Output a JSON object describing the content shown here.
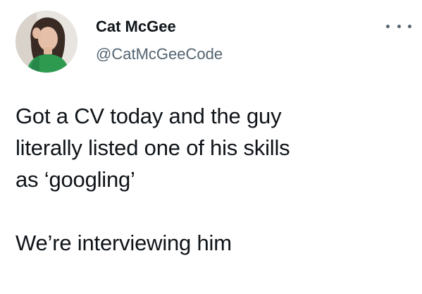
{
  "tweet": {
    "author": {
      "display_name": "Cat McGee",
      "handle": "@CatMcGeeCode",
      "avatar_icon": "profile-photo"
    },
    "more_icon": "more-options-icon",
    "text": "Got a CV today and the guy\nliterally listed one of his skills\nas ‘googling’\n\nWe’re interviewing him"
  },
  "colors": {
    "text": "#0f1419",
    "secondary_text": "#536471",
    "background": "#ffffff"
  }
}
